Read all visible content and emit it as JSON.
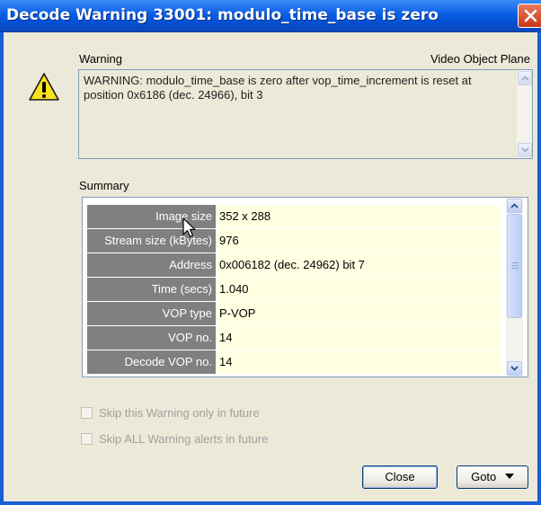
{
  "window": {
    "title": "Decode Warning 33001: modulo_time_base is zero"
  },
  "header": {
    "left_label": "Warning",
    "right_label": "Video Object Plane"
  },
  "message": {
    "text": "WARNING: modulo_time_base is zero after vop_time_increment is reset at position 0x6186 (dec. 24966), bit 3"
  },
  "summary": {
    "label": "Summary",
    "rows": [
      {
        "name": "Image size",
        "value": "352 x 288"
      },
      {
        "name": "Stream size (kBytes)",
        "value": "976"
      },
      {
        "name": "Address",
        "value": "0x006182 (dec. 24962) bit 7"
      },
      {
        "name": "Time (secs)",
        "value": "1.040"
      },
      {
        "name": "VOP type",
        "value": "P-VOP"
      },
      {
        "name": "VOP no.",
        "value": "14"
      },
      {
        "name": "Decode VOP no.",
        "value": "14"
      }
    ]
  },
  "options": {
    "skip_this": "Skip this Warning only in future",
    "skip_all": "Skip ALL Warning alerts in future",
    "skip_this_checked": false,
    "skip_all_checked": false
  },
  "buttons": {
    "close": "Close",
    "goto": "Goto"
  },
  "icons": {
    "warning": "warning-triangle-icon",
    "close": "close-x-icon",
    "dropdown": "triangle-down-icon"
  },
  "colors": {
    "titlebar": "#0a5ee6",
    "dialog_bg": "#ece9d8",
    "name_cell": "#808080",
    "value_cell": "#ffffe1"
  }
}
